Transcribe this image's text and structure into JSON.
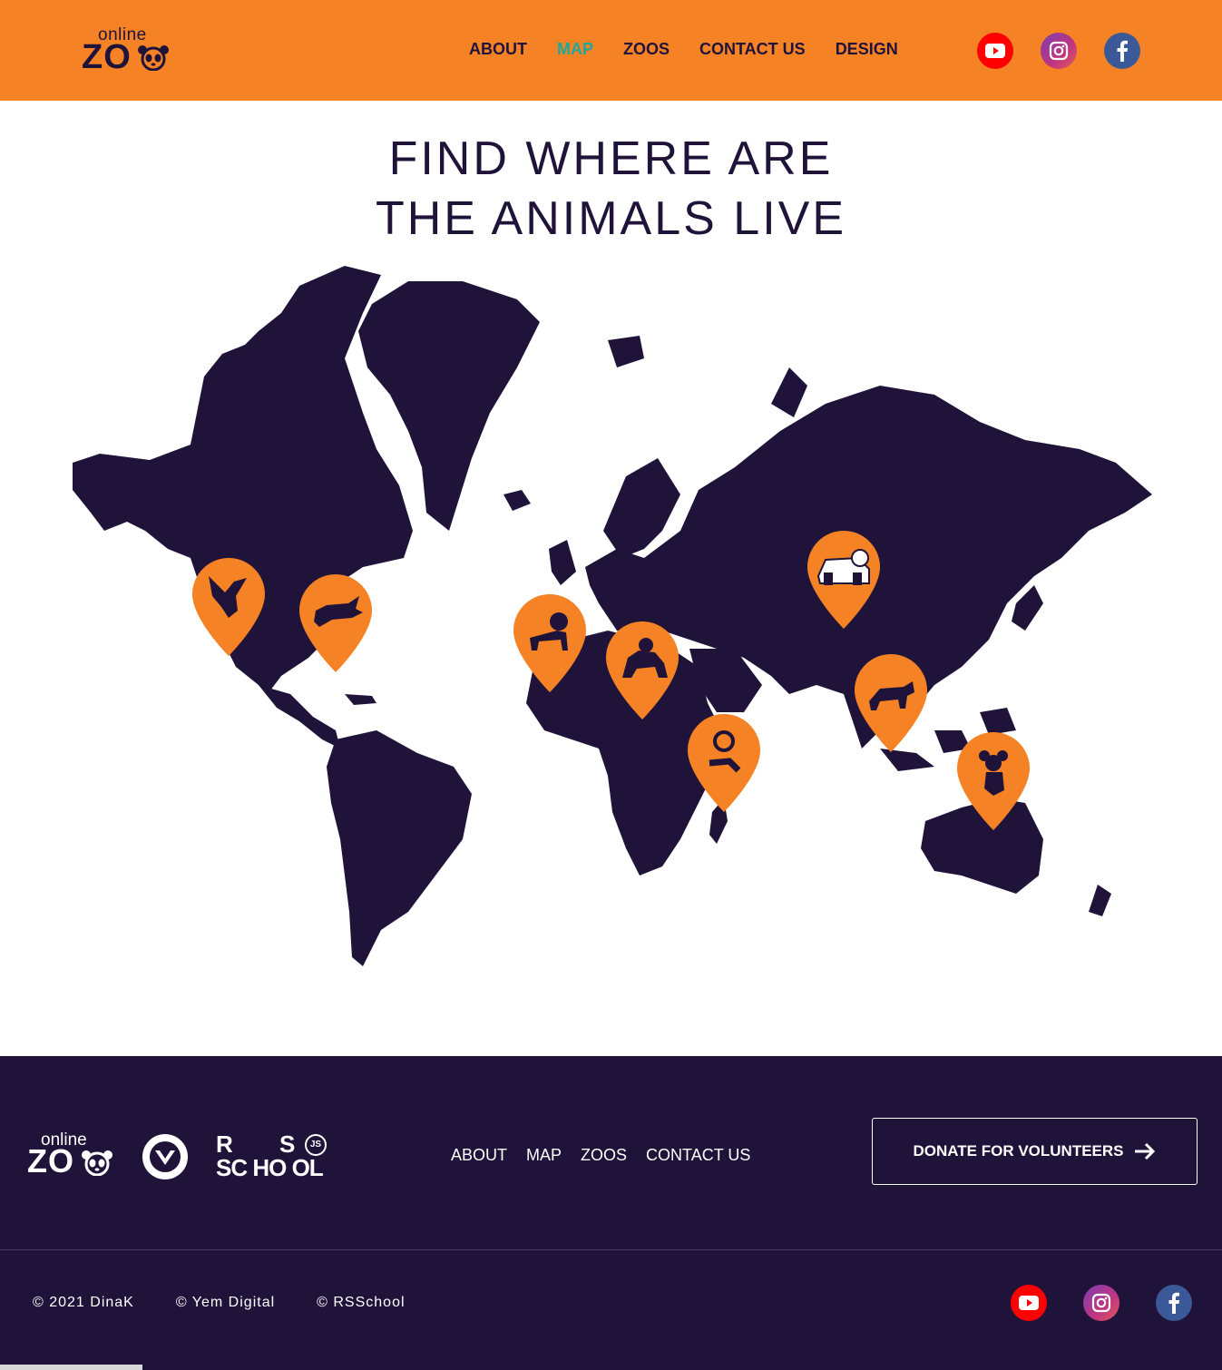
{
  "header": {
    "logo_small": "online",
    "logo_big": "ZO",
    "nav": [
      {
        "label": "ABOUT",
        "active": false
      },
      {
        "label": "MAP",
        "active": true
      },
      {
        "label": "ZOOS",
        "active": false
      },
      {
        "label": "CONTACT US",
        "active": false
      },
      {
        "label": "DESIGN",
        "active": false
      }
    ],
    "social": [
      "youtube-icon",
      "instagram-icon",
      "facebook-icon"
    ]
  },
  "main": {
    "title_line1": "FIND WHERE ARE",
    "title_line2": "THE ANIMALS LIVE",
    "map_pins": [
      {
        "animal": "eagle",
        "icon": "eagle-icon"
      },
      {
        "animal": "alligator",
        "icon": "alligator-icon"
      },
      {
        "animal": "lion",
        "icon": "lion-icon"
      },
      {
        "animal": "gorilla",
        "icon": "gorilla-icon"
      },
      {
        "animal": "lemur",
        "icon": "lemur-icon"
      },
      {
        "animal": "panda",
        "icon": "panda-icon"
      },
      {
        "animal": "tiger",
        "icon": "tiger-icon"
      },
      {
        "animal": "koala",
        "icon": "koala-icon"
      }
    ]
  },
  "footer": {
    "logo_small": "online",
    "logo_big": "ZO",
    "rs_line1a": "R",
    "rs_line1b": "S",
    "rs_js": "JS",
    "rs_line2": "SC HO OL",
    "nav": [
      "ABOUT",
      "MAP",
      "ZOOS",
      "CONTACT US"
    ],
    "donate_label": "DONATE FOR VOLUNTEERS",
    "copyrights": [
      "© 2021 DinaK",
      "© Yem Digital",
      "© RSSchool"
    ],
    "social": [
      "youtube-icon",
      "instagram-icon",
      "facebook-icon"
    ]
  },
  "colors": {
    "orange": "#f58225",
    "navy": "#20133a",
    "active_nav": "#1fa79b"
  }
}
